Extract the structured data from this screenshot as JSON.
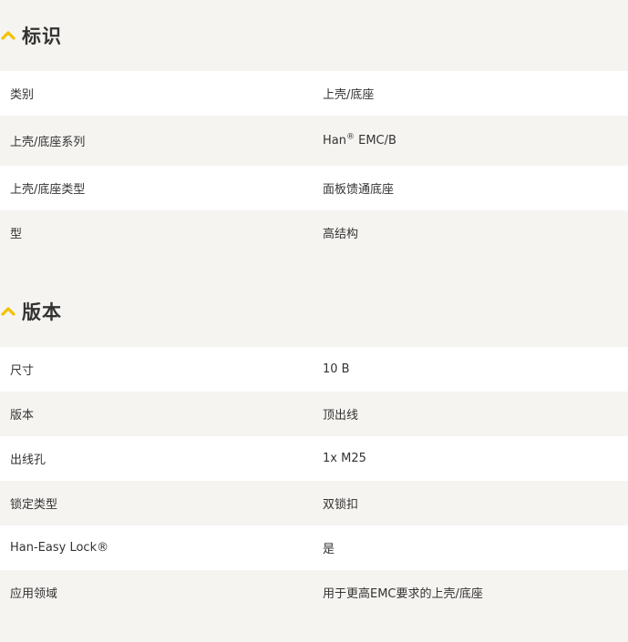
{
  "colors": {
    "accent": "#f2c200",
    "background": "#f5f4f1",
    "row_white": "#ffffff",
    "text": "#333333"
  },
  "sections": [
    {
      "icon": "chevron-up-icon",
      "title": "标识",
      "rows": [
        {
          "label": "类别",
          "value": "上壳/底座"
        },
        {
          "label": "上壳/底座系列",
          "value_prefix": "Han",
          "value_sup": "®",
          "value_suffix": " EMC/B"
        },
        {
          "label": "上壳/底座类型",
          "value": "面板馈通底座"
        },
        {
          "label": "型",
          "value": "高结构"
        }
      ]
    },
    {
      "icon": "chevron-up-icon",
      "title": "版本",
      "rows": [
        {
          "label": "尺寸",
          "value": "10 B"
        },
        {
          "label": "版本",
          "value": "顶出线"
        },
        {
          "label": "出线孔",
          "value": "1x M25"
        },
        {
          "label": "锁定类型",
          "value": "双锁扣"
        },
        {
          "label": "Han-Easy Lock®",
          "value": "是"
        },
        {
          "label": "应用领域",
          "value": "用于更高EMC要求的上壳/底座"
        }
      ]
    }
  ]
}
